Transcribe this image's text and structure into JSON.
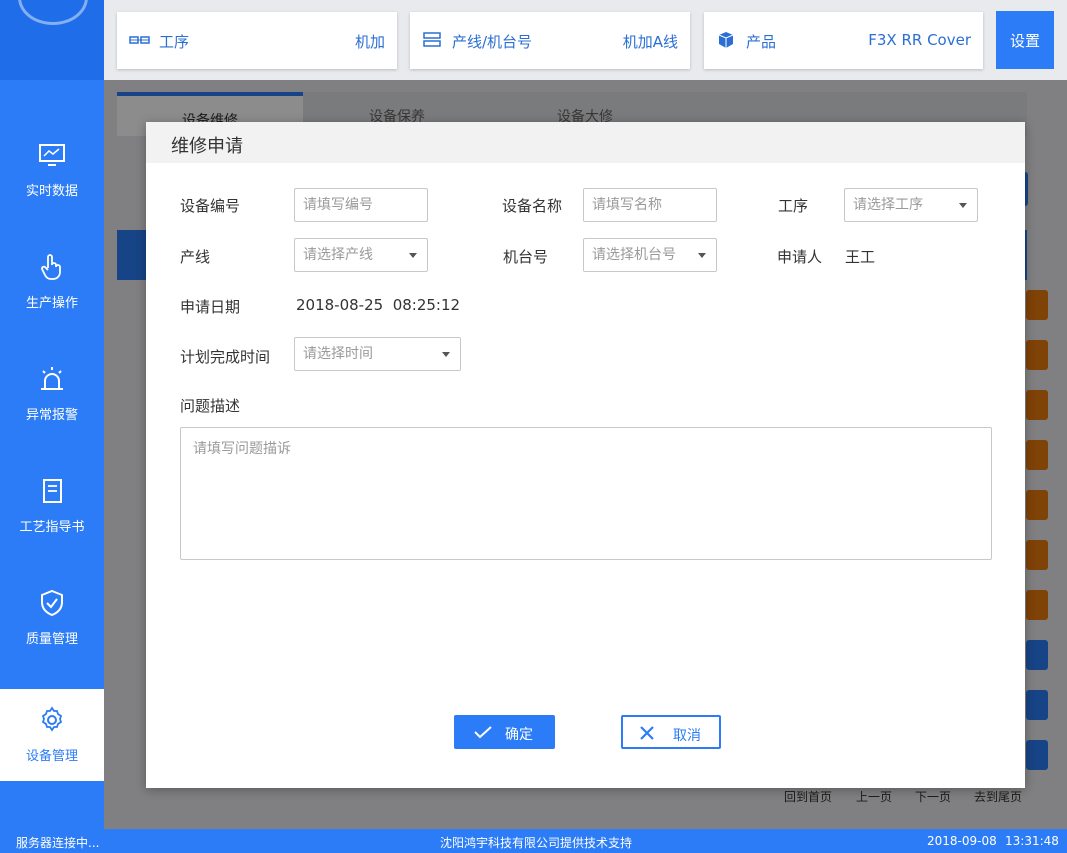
{
  "header": {
    "process": {
      "label": "工序",
      "value": "机加"
    },
    "line": {
      "label": "产线/机台号",
      "value": "机加A线"
    },
    "product": {
      "label": "产品",
      "value": "F3X RR Cover"
    },
    "settings_label": "设置"
  },
  "sidebar": {
    "items": [
      {
        "label": "实时数据",
        "icon": "monitor-icon"
      },
      {
        "label": "生产操作",
        "icon": "hand-pointer-icon"
      },
      {
        "label": "异常报警",
        "icon": "alarm-light-icon"
      },
      {
        "label": "工艺指导书",
        "icon": "document-icon"
      },
      {
        "label": "质量管理",
        "icon": "shield-check-icon"
      },
      {
        "label": "设备管理",
        "icon": "gear-icon",
        "active": true
      }
    ]
  },
  "background": {
    "tabs": [
      "设备维修",
      "设备保养",
      "设备大修"
    ],
    "pager": [
      "回到首页",
      "上一页",
      "下一页",
      "去到尾页"
    ]
  },
  "modal": {
    "title": "维修申请",
    "fields": {
      "device_no": {
        "label": "设备编号",
        "placeholder": "请填写编号"
      },
      "device_name": {
        "label": "设备名称",
        "placeholder": "请填写名称"
      },
      "process": {
        "label": "工序",
        "placeholder": "请选择工序"
      },
      "line": {
        "label": "产线",
        "placeholder": "请选择产线"
      },
      "machine_no": {
        "label": "机台号",
        "placeholder": "请选择机台号"
      },
      "applicant": {
        "label": "申请人",
        "value": "王工"
      },
      "apply_date": {
        "label": "申请日期",
        "value": "2018-08-25  08:25:12"
      },
      "plan_time": {
        "label": "计划完成时间",
        "placeholder": "请选择时间"
      },
      "description": {
        "label": "问题描述",
        "placeholder": "请填写问题描诉"
      }
    },
    "confirm_label": "确定",
    "cancel_label": "取消"
  },
  "statusbar": {
    "connection": "服务器连接中...",
    "support": "沈阳鸿宇科技有限公司提供技术支持",
    "date": "2018-09-08",
    "time": "13:31:48"
  },
  "colors": {
    "primary": "#2b7cf6",
    "orange": "#e8780e"
  }
}
